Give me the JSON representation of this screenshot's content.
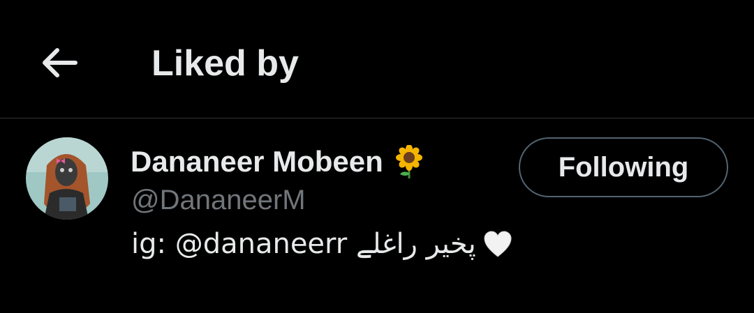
{
  "header": {
    "title": "Liked by",
    "back_icon": "arrow-left-icon"
  },
  "user": {
    "display_name": "Dananeer Mobeen",
    "name_emoji": "sunflower-icon",
    "handle": "@DananeerM",
    "bio": "ig: @dananeerr پخیر راغلے",
    "bio_emoji": "white-heart-icon",
    "follow_button_label": "Following"
  },
  "colors": {
    "background": "#000000",
    "primary_text": "#e7e9ea",
    "secondary_text": "#71767b",
    "divider": "#2f3336",
    "button_border": "#536471"
  }
}
